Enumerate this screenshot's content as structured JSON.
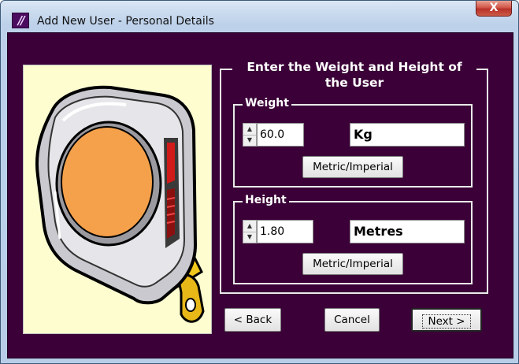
{
  "window": {
    "title": "Add New User - Personal Details",
    "close_glyph": "X"
  },
  "app_icon": {
    "glyph": "//"
  },
  "outer_group": {
    "title": "Enter the Weight and Height of the User"
  },
  "weight": {
    "title": "Weight",
    "value": "60.0",
    "unit": "Kg",
    "toggle_label": "Metric/Imperial"
  },
  "height": {
    "title": "Height",
    "value": "1.80",
    "unit": "Metres",
    "toggle_label": "Metric/Imperial"
  },
  "buttons": {
    "back": "< Back",
    "cancel": "Cancel",
    "next": "Next >"
  },
  "spinner_glyphs": {
    "up": "▲",
    "down": "▼"
  },
  "picture": {
    "icon": "tape-measure-icon"
  },
  "colors": {
    "client_background": "#3a0037",
    "picture_background": "#fdfdd0",
    "tape_face": "#f5a04a",
    "tape_yellow": "#f2c81c"
  }
}
